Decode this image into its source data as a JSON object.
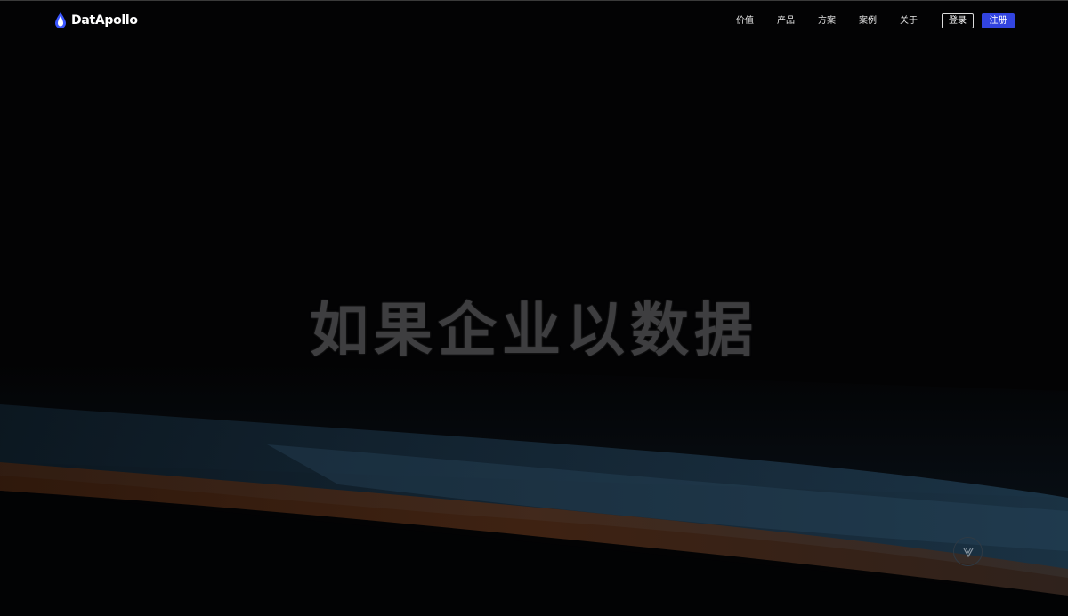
{
  "header": {
    "logo_text": "DatApollo",
    "nav": [
      "价值",
      "产品",
      "方案",
      "案例",
      "关于"
    ],
    "login_label": "登录",
    "register_label": "注册"
  },
  "hero": {
    "title": "如果企业以数据"
  },
  "colors": {
    "accent": "#3244e0",
    "background": "#030304",
    "wave_blue": "#1a3142",
    "wave_orange": "#4a2a18"
  },
  "icons": {
    "logo": "water-drop-icon",
    "scroll": "chevron-down-icon"
  }
}
